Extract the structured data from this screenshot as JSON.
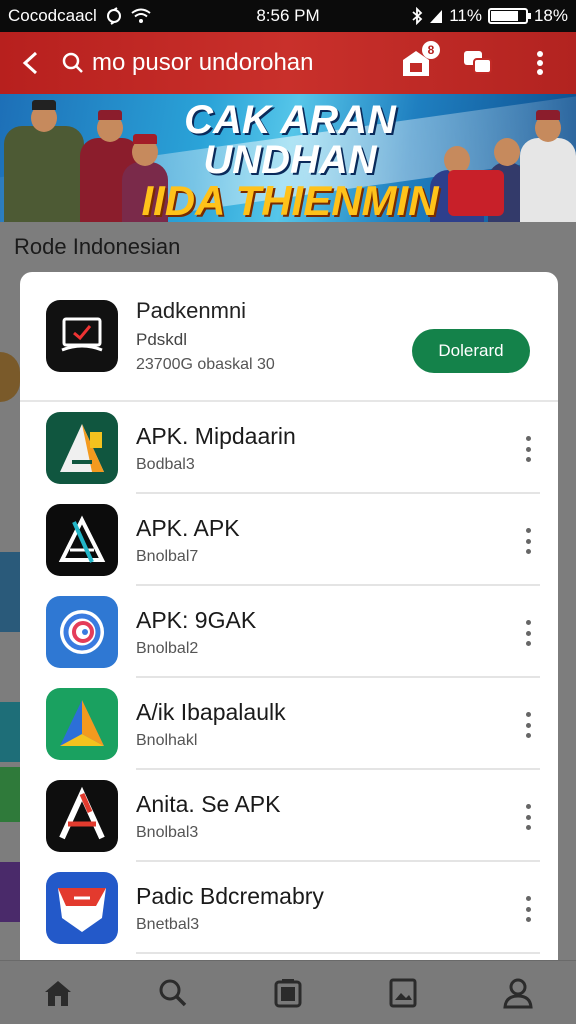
{
  "status_bar": {
    "carrier": "Cocodcaacl",
    "time": "8:56 PM",
    "battery_text": "11%",
    "signal_text": "18%",
    "battery_level": 0.75
  },
  "app_bar": {
    "search_text": "mo pusor undorohan",
    "badge": "8"
  },
  "banner": {
    "line1": "CAK ARAN UNDHAN",
    "line2": "IIDA THIENMIN"
  },
  "background": {
    "section_title": "Rode Indonesian"
  },
  "featured": {
    "name": "Padkenmni",
    "subtitle": "Pdskdl",
    "meta": "23700G obaskal  30",
    "download_label": "Dolerard"
  },
  "apps": [
    {
      "name": "APK. Mipdaarin",
      "sub": "Bodbal3",
      "icon": "apk-a-icon",
      "bg": "#10563f"
    },
    {
      "name": "APK. APK",
      "sub": "Bnolbal7",
      "icon": "apk-triangle-icon",
      "bg": "#0c0c0c"
    },
    {
      "name": "APK: 9GAK",
      "sub": "Bnolbal2",
      "icon": "swirl-icon",
      "bg": "#2f78d3"
    },
    {
      "name": "A/ik Ibapalaulk",
      "sub": "Bnolhakl",
      "icon": "arrow-a-icon",
      "bg": "#1aa160"
    },
    {
      "name": "Anita. Se APK",
      "sub": "Bnolbal3",
      "icon": "letter-a-icon",
      "bg": "#0e0e0e"
    },
    {
      "name": "Padic Bdcremabry",
      "sub": "Bnetbal3",
      "icon": "shield-icon",
      "bg": "#2359c9"
    }
  ],
  "nav": [
    "home-icon",
    "search-icon",
    "apps-icon",
    "image-icon",
    "profile-icon"
  ]
}
